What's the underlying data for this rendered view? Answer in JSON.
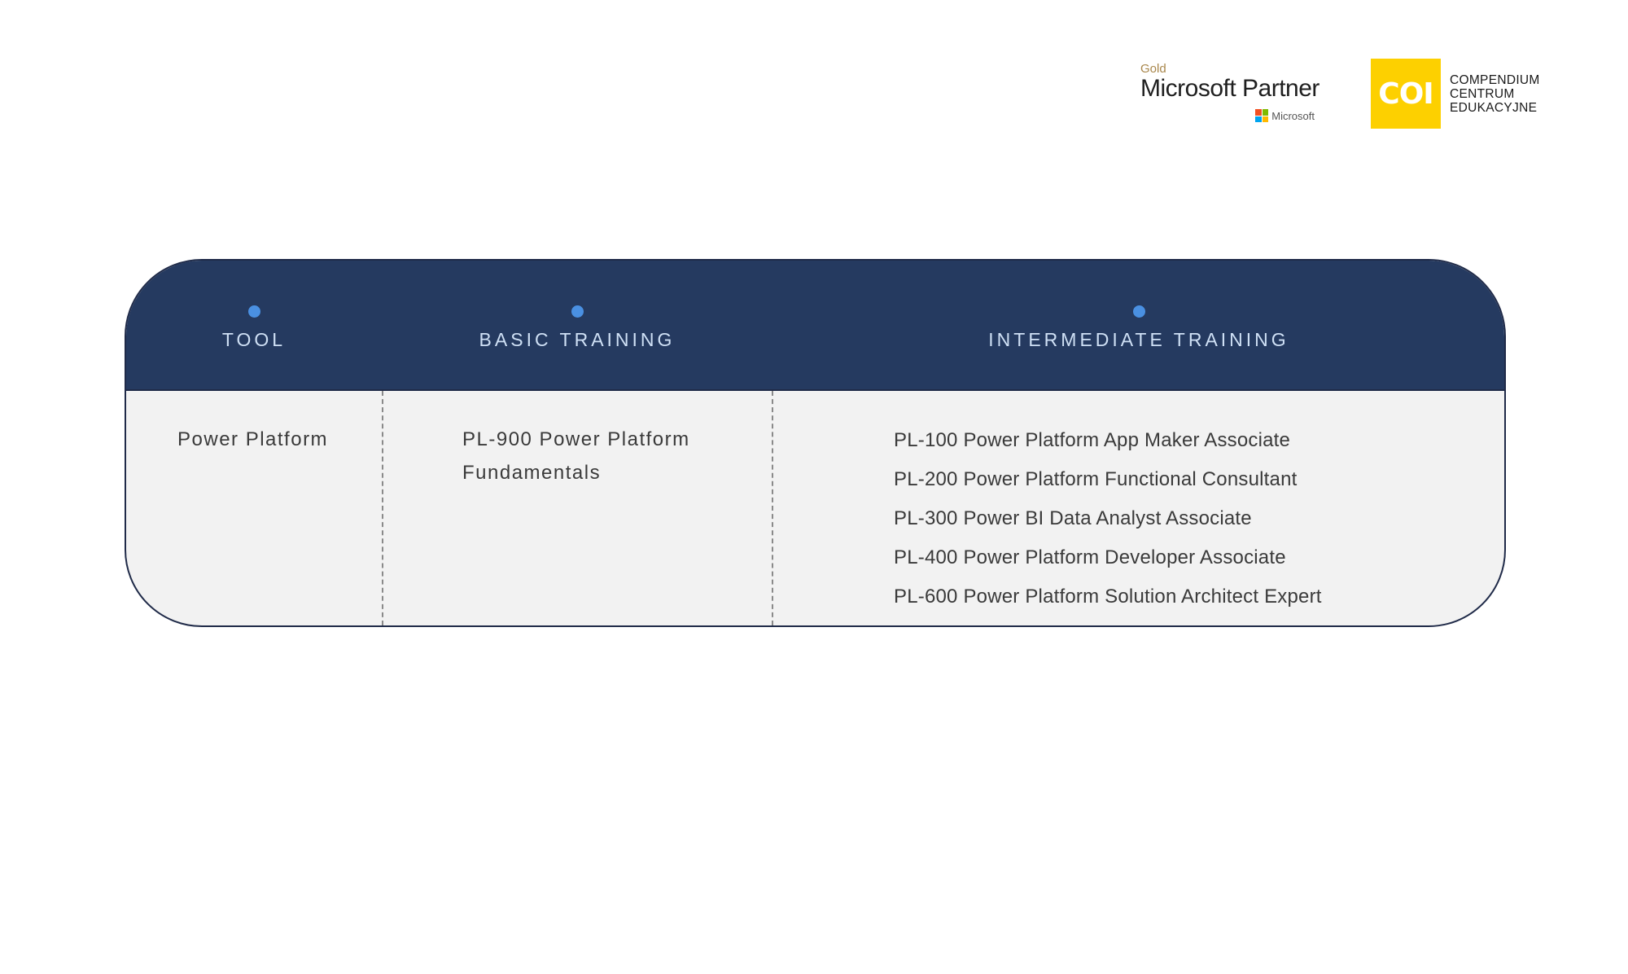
{
  "logos": {
    "ms_partner": {
      "tier": "Gold",
      "title": "Microsoft Partner",
      "sub": "Microsoft",
      "grid_colors": [
        "#f25022",
        "#7fba00",
        "#00a4ef",
        "#ffb900"
      ]
    },
    "coi": {
      "mark": "COI",
      "lines": [
        "COMPENDIUM",
        "CENTRUM",
        "EDUKACYJNE"
      ],
      "color": "#fdd000"
    }
  },
  "table": {
    "headers": [
      "TOOL",
      "BASIC TRAINING",
      "INTERMEDIATE TRAINING"
    ],
    "tool": "Power Platform",
    "basic": [
      "PL-900 Power Platform",
      "Fundamentals"
    ],
    "intermediate": [
      "PL-100 Power Platform App Maker Associate",
      "PL-200 Power Platform Functional Consultant",
      "PL-300 Power BI Data Analyst Associate",
      "PL-400 Power Platform Developer Associate",
      "PL-600 Power Platform Solution Architect Expert"
    ],
    "colors": {
      "header_bg": "#253a60",
      "dot": "#4a90e2",
      "body_bg": "#f2f2f2"
    }
  }
}
